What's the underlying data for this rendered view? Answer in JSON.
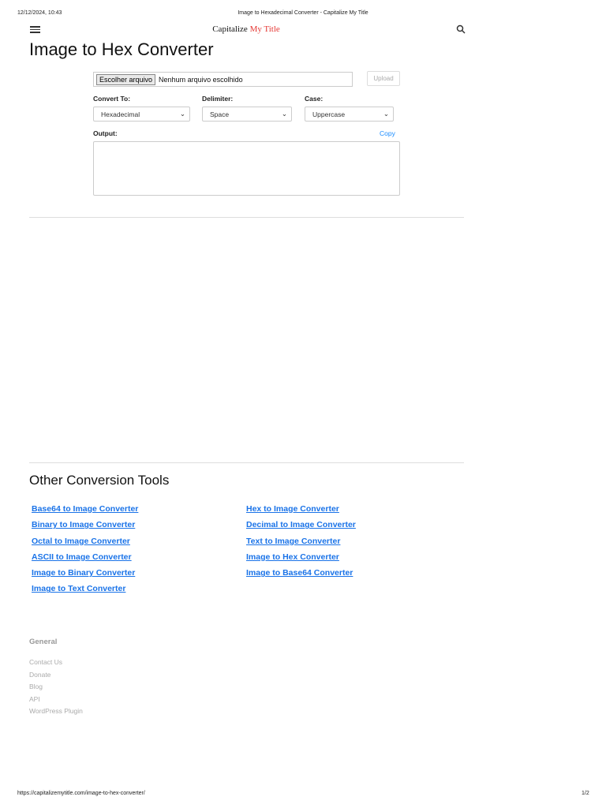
{
  "print_header": {
    "datetime": "12/12/2024, 10:43",
    "title": "Image to Hexadecimal Converter - Capitalize My Title"
  },
  "nav": {
    "brand_part1": "Capitalize",
    "brand_part2": "My Title",
    "brand_accent": "#e53935"
  },
  "main": {
    "title": "Image to Hex Converter",
    "file_button": "Escolher arquivo",
    "file_status": "Nenhum arquivo escolhido",
    "upload": "Upload",
    "convert_to_label": "Convert To:",
    "convert_to_value": "Hexadecimal",
    "delimiter_label": "Delimiter:",
    "delimiter_value": "Space",
    "case_label": "Case:",
    "case_value": "Uppercase",
    "output_label": "Output:",
    "copy": "Copy",
    "output_value": ""
  },
  "other_tools": {
    "heading": "Other Conversion Tools",
    "left": [
      "Base64 to Image Converter",
      "Binary to Image Converter",
      "Octal to Image Converter",
      "ASCII to Image Converter",
      "Image to Binary Converter",
      "Image to Text Converter"
    ],
    "right": [
      "Hex to Image Converter",
      "Decimal to Image Converter",
      "Text to Image Converter",
      "Image to Hex Converter",
      "Image to Base64 Converter"
    ]
  },
  "footer": {
    "heading": "General",
    "links": [
      "Contact Us",
      "Donate",
      "Blog",
      "API",
      "WordPress Plugin"
    ]
  },
  "print_footer": {
    "url": "https://capitalizemytitle.com/image-to-hex-converter/",
    "page": "1/2"
  }
}
